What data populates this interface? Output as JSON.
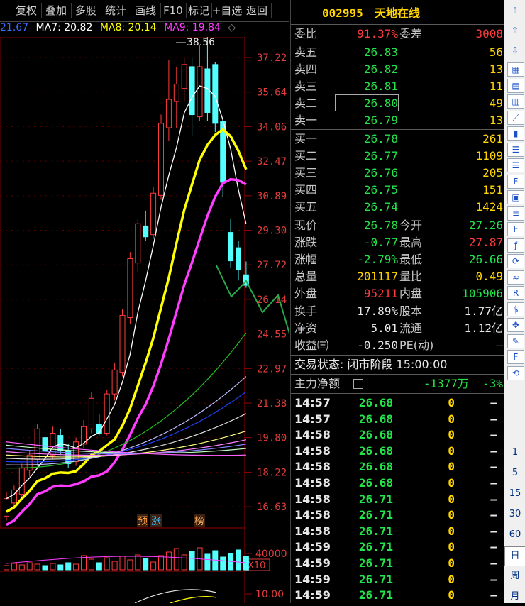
{
  "toolbar": {
    "buttons": [
      "复权",
      "叠加",
      "多股",
      "统计",
      "画线",
      "F10",
      "标记",
      "+自选",
      "返回"
    ]
  },
  "ma_legend": {
    "first": "21.67",
    "ma7": "MA7: 20.82",
    "ma8": "MA8: 20.14",
    "ma9": "MA9: 19.84",
    "marker": "◇"
  },
  "chart": {
    "peak_label": "38.56",
    "y_labels": [
      "37.22",
      "35.64",
      "34.06",
      "32.47",
      "30.89",
      "29.30",
      "27.72",
      "26.14",
      "24.55",
      "22.97",
      "21.38",
      "19.80",
      "18.22",
      "16.63"
    ],
    "vol_label": "40000",
    "vol_unit": "X10",
    "ind_label": "10.00",
    "tags": [
      "预",
      "涨",
      "榜"
    ]
  },
  "quote": {
    "code": "002995",
    "name": "天地在线",
    "weibi_label": "委比",
    "weibi": "91.37%",
    "weicha_label": "委差",
    "weicha": "3008",
    "sells": [
      {
        "label": "卖五",
        "price": "26.83",
        "vol": "56"
      },
      {
        "label": "卖四",
        "price": "26.82",
        "vol": "13"
      },
      {
        "label": "卖三",
        "price": "26.81",
        "vol": "11"
      },
      {
        "label": "卖二",
        "price": "26.80",
        "vol": "49"
      },
      {
        "label": "卖一",
        "price": "26.79",
        "vol": "13"
      }
    ],
    "buys": [
      {
        "label": "买一",
        "price": "26.78",
        "vol": "261"
      },
      {
        "label": "买二",
        "price": "26.77",
        "vol": "1109"
      },
      {
        "label": "买三",
        "price": "26.76",
        "vol": "205"
      },
      {
        "label": "买四",
        "price": "26.75",
        "vol": "151"
      },
      {
        "label": "买五",
        "price": "26.74",
        "vol": "1424"
      }
    ],
    "stats": [
      {
        "l1": "现价",
        "v1": "26.78",
        "c1": "green",
        "l2": "今开",
        "v2": "27.26",
        "c2": "green"
      },
      {
        "l1": "涨跌",
        "v1": "-0.77",
        "c1": "green",
        "l2": "最高",
        "v2": "27.87",
        "c2": "red"
      },
      {
        "l1": "涨幅",
        "v1": "-2.79%",
        "c1": "green",
        "l2": "最低",
        "v2": "26.66",
        "c2": "green"
      },
      {
        "l1": "总量",
        "v1": "201117",
        "c1": "yellow",
        "l2": "量比",
        "v2": "0.49",
        "c2": "yellow"
      },
      {
        "l1": "外盘",
        "v1": "95211",
        "c1": "red",
        "l2": "内盘",
        "v2": "105906",
        "c2": "green"
      }
    ],
    "stats2": [
      {
        "l1": "换手",
        "v1": "17.89%",
        "l2": "股本",
        "v2": "1.77亿"
      },
      {
        "l1": "净资",
        "v1": "5.01",
        "l2": "流通",
        "v2": "1.12亿"
      },
      {
        "l1": "收益㈢",
        "v1": "-0.250",
        "l2": "PE(动)",
        "v2": "—"
      }
    ],
    "trade_status": "交易状态: 闭市阶段 15:00:00",
    "main_flow_label": "主力净额",
    "main_flow": "-1377万",
    "main_flow_pct": "-3%",
    "ticks": [
      {
        "t": "14:57",
        "p": "26.68",
        "v": "0",
        "d": "—"
      },
      {
        "t": "14:57",
        "p": "26.68",
        "v": "0",
        "d": "—"
      },
      {
        "t": "14:58",
        "p": "26.68",
        "v": "0",
        "d": "—"
      },
      {
        "t": "14:58",
        "p": "26.68",
        "v": "0",
        "d": "—"
      },
      {
        "t": "14:58",
        "p": "26.68",
        "v": "0",
        "d": "—"
      },
      {
        "t": "14:58",
        "p": "26.68",
        "v": "0",
        "d": "—"
      },
      {
        "t": "14:58",
        "p": "26.71",
        "v": "0",
        "d": "—"
      },
      {
        "t": "14:58",
        "p": "26.71",
        "v": "0",
        "d": "—"
      },
      {
        "t": "14:58",
        "p": "26.71",
        "v": "0",
        "d": "—"
      },
      {
        "t": "14:59",
        "p": "26.71",
        "v": "0",
        "d": "—"
      },
      {
        "t": "14:59",
        "p": "26.71",
        "v": "0",
        "d": "—"
      },
      {
        "t": "14:59",
        "p": "26.71",
        "v": "0",
        "d": "—"
      },
      {
        "t": "14:59",
        "p": "26.71",
        "v": "0",
        "d": "—"
      }
    ]
  },
  "sidebar": {
    "icons": [
      "up-arrow-icon",
      "up-outline-icon",
      "down-outline-icon",
      "chart-icon",
      "grid-icon",
      "grid2-icon",
      "trend-icon",
      "candle-icon",
      "list-icon",
      "list2-icon",
      "f10-icon",
      "doc-icon",
      "note-icon",
      "f12-icon",
      "fx-icon",
      "refresh-icon",
      "wave-icon",
      "rsi-icon",
      "dollar-icon",
      "move-icon",
      "pen-icon",
      "f5-icon",
      "reload-icon"
    ],
    "periods": [
      "1",
      "5",
      "15",
      "30",
      "60",
      "日",
      "周",
      "月"
    ]
  }
}
